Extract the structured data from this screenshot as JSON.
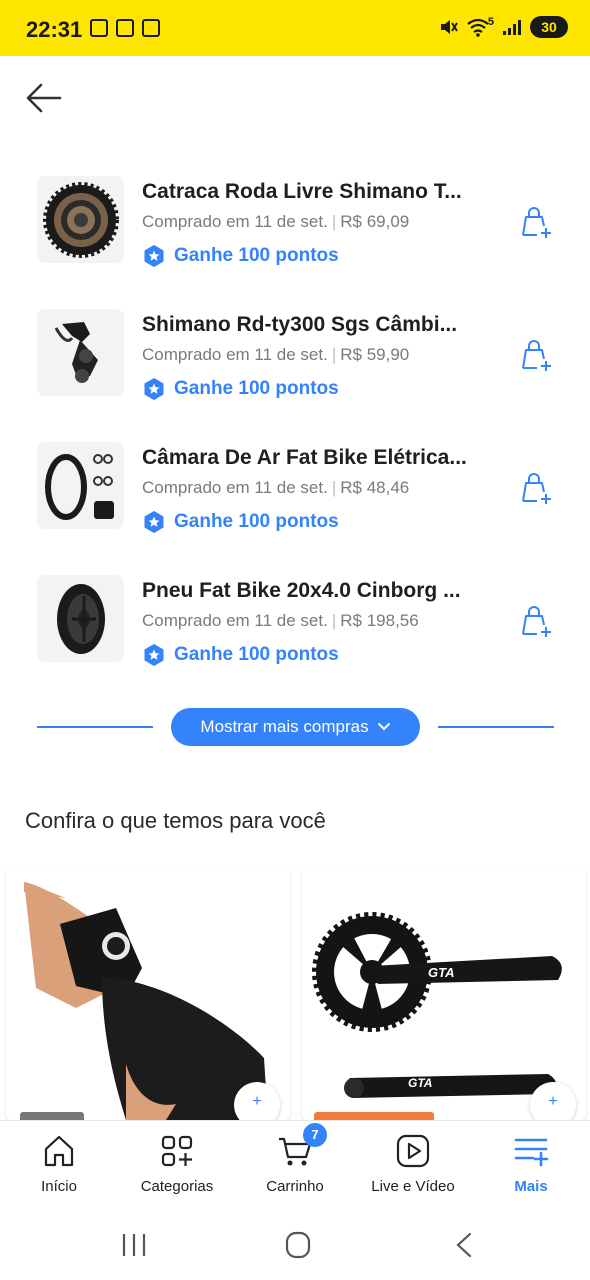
{
  "status_bar": {
    "time": "22:31",
    "battery": "30",
    "wifi_label": "5"
  },
  "purchases": [
    {
      "title": "Catraca Roda Livre Shimano T...",
      "date": "Comprado em 11 de set.",
      "price": "R$ 69,09",
      "points": "Ganhe 100 pontos",
      "image_icon": "freewheel-sprocket-image"
    },
    {
      "title": "Shimano Rd-ty300 Sgs Câmbi...",
      "date": "Comprado em 11 de set.",
      "price": "R$ 59,90",
      "points": "Ganhe 100 pontos",
      "image_icon": "rear-derailleur-image"
    },
    {
      "title": "Câmara De Ar Fat Bike Elétrica...",
      "date": "Comprado em 11 de set.",
      "price": "R$ 48,46",
      "points": "Ganhe 100 pontos",
      "image_icon": "inner-tube-image"
    },
    {
      "title": "Pneu Fat Bike 20x4.0 Cinborg ...",
      "date": "Comprado em 11 de set.",
      "price": "R$ 198,56",
      "points": "Ganhe 100 pontos",
      "image_icon": "tire-image"
    }
  ],
  "show_more": {
    "label": "Mostrar mais compras"
  },
  "recommendations": {
    "title": "Confira o que temos para você",
    "items": [
      {
        "image_icon": "glove-image",
        "brand_text": ""
      },
      {
        "image_icon": "crankset-image",
        "brand_text": "GTA"
      }
    ]
  },
  "bottom_nav": {
    "items": [
      {
        "label": "Início",
        "icon": "home-icon"
      },
      {
        "label": "Categorias",
        "icon": "categories-icon"
      },
      {
        "label": "Carrinho",
        "icon": "cart-icon",
        "badge": "7"
      },
      {
        "label": "Live e Vídeo",
        "icon": "video-icon"
      },
      {
        "label": "Mais",
        "icon": "menu-icon",
        "active": true
      }
    ]
  },
  "colors": {
    "brand_yellow": "#ffe600",
    "accent_blue": "#3483fa",
    "muted_text": "#7a7a7a"
  }
}
